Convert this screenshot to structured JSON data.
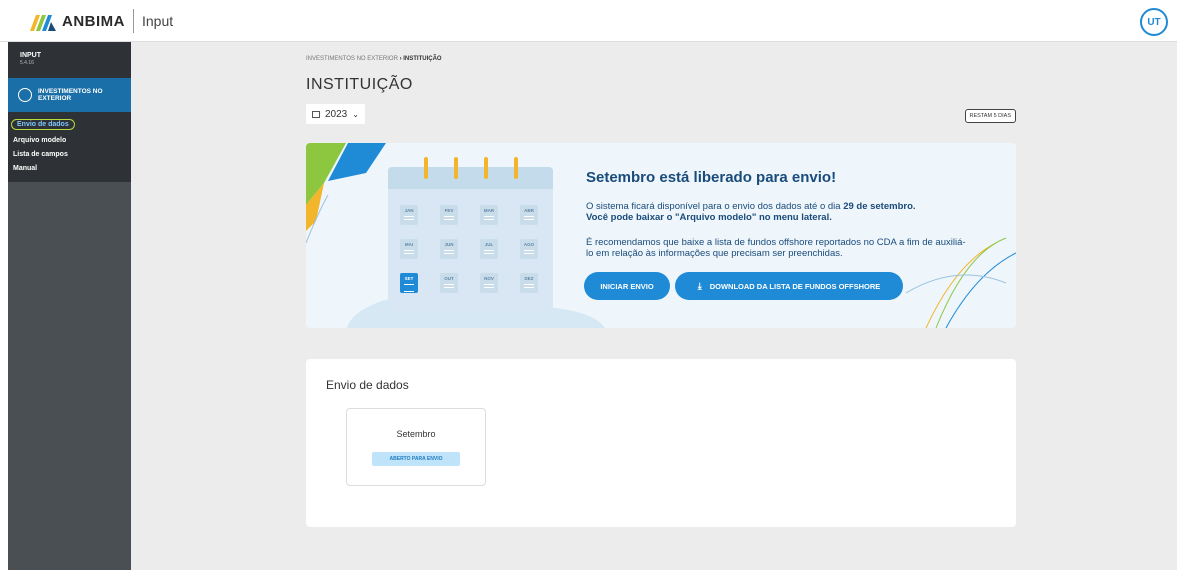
{
  "header": {
    "brand": "ANBIMA",
    "app": "Input",
    "avatar": "UT"
  },
  "sidebar": {
    "title": "INPUT",
    "subtitle": "5.4.16",
    "section": "INVESTIMENTOS NO EXTERIOR",
    "items": [
      {
        "label": "Envio de dados",
        "active": true
      },
      {
        "label": "Arquivo modelo"
      },
      {
        "label": "Lista de campos"
      },
      {
        "label": "Manual"
      }
    ]
  },
  "breadcrumb": {
    "parent": "INVESTIMENTOS NO EXTERIOR",
    "sep": "›",
    "current": "INSTITUIÇÃO"
  },
  "page_title": "INSTITUIÇÃO",
  "year_select": {
    "value": "2023"
  },
  "days_badge": "RESTAM 5 DIAS",
  "banner": {
    "title": "Setembro está liberado para envio!",
    "p1_a": "O sistema ficará disponível para o envio dos dados até o dia ",
    "p1_b": "29 de setembro.",
    "p1_c": "Você pode baixar o \"Arquivo modelo\" no menu lateral.",
    "p2": "É recomendamos que baixe a lista de fundos offshore reportados no CDA a fim de auxiliá-lo em relação às informações que precisam ser preenchidas.",
    "btn_start": "INICIAR ENVIO",
    "btn_download": "DOWNLOAD DA LISTA DE FUNDOS OFFSHORE",
    "months": [
      "JAN",
      "FEV",
      "MAR",
      "ABR",
      "MAI",
      "JUN",
      "JUL",
      "AGO",
      "SET",
      "OUT",
      "NOV",
      "DEZ"
    ],
    "active_month": "SET"
  },
  "envio": {
    "title": "Envio de dados",
    "month": "Setembro",
    "status": "ABERTO PARA ENVIO"
  },
  "colors": {
    "primary": "#1f8ad6",
    "navy": "#1a4b7a",
    "sidebar": "#4a4f54",
    "accent_green": "#b6dc3c",
    "accent_yellow": "#f3b52b"
  }
}
